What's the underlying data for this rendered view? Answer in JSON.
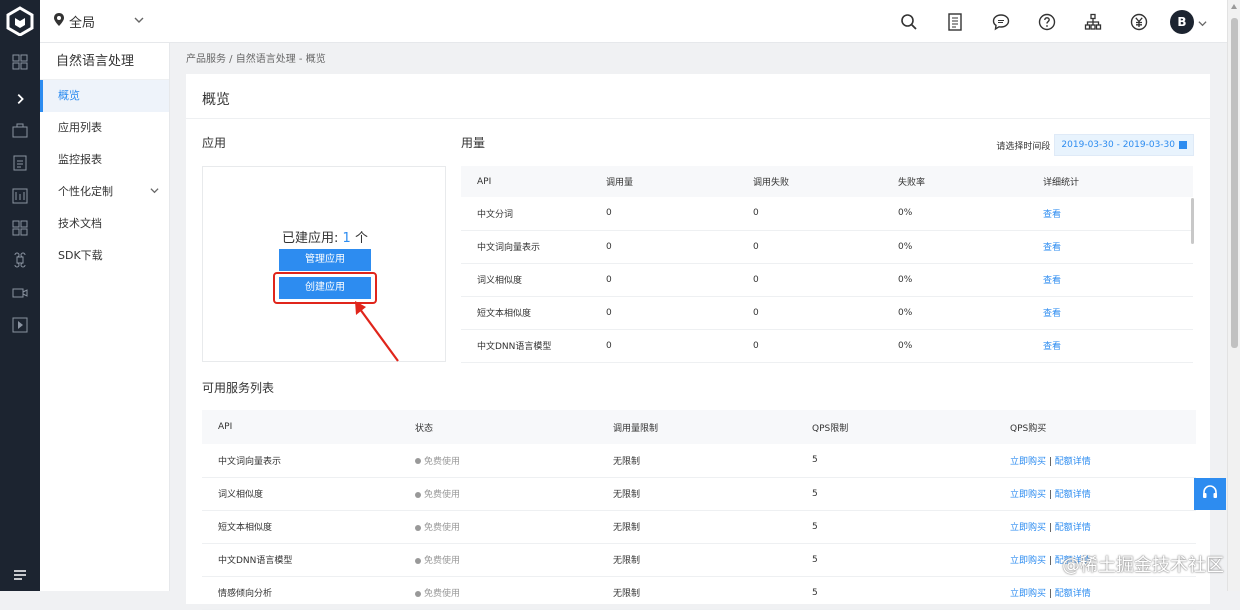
{
  "topbar": {
    "region": "全局",
    "avatar_letter": "B"
  },
  "icons": {
    "rail": [
      "grid-icon",
      "chevron-right-icon",
      "briefcase-icon",
      "doc-icon",
      "chart-doc-icon",
      "apps-icon",
      "command-icon",
      "video-icon",
      "play-icon",
      "menu-icon"
    ],
    "tools": [
      "search-icon",
      "document-icon",
      "chat-icon",
      "help-icon",
      "network-icon",
      "currency-icon"
    ]
  },
  "sidebar": {
    "title": "自然语言处理",
    "items": [
      {
        "label": "概览",
        "active": true
      },
      {
        "label": "应用列表"
      },
      {
        "label": "监控报表"
      },
      {
        "label": "个性化定制",
        "expandable": true
      },
      {
        "label": "技术文档"
      },
      {
        "label": "SDK下载"
      }
    ]
  },
  "breadcrumb": "产品服务 / 自然语言处理 - 概览",
  "page": {
    "title": "概览"
  },
  "apps": {
    "heading": "应用",
    "count_prefix": "已建应用: ",
    "count": "1",
    "count_suffix": " 个",
    "manage_label": "管理应用",
    "create_label": "创建应用"
  },
  "usage": {
    "heading": "用量",
    "date_label": "请选择时间段",
    "date_range": "2019-03-30 - 2019-03-30",
    "columns": [
      "API",
      "调用量",
      "调用失败",
      "失败率",
      "详细统计"
    ],
    "rows": [
      [
        "中文分词",
        "0",
        "0",
        "0%",
        "查看"
      ],
      [
        "中文词向量表示",
        "0",
        "0",
        "0%",
        "查看"
      ],
      [
        "词义相似度",
        "0",
        "0",
        "0%",
        "查看"
      ],
      [
        "短文本相似度",
        "0",
        "0",
        "0%",
        "查看"
      ],
      [
        "中文DNN语言模型",
        "0",
        "0",
        "0%",
        "查看"
      ]
    ]
  },
  "services": {
    "heading": "可用服务列表",
    "columns": [
      "API",
      "状态",
      "调用量限制",
      "QPS限制",
      "QPS购买"
    ],
    "rows": [
      {
        "api": "中文词向量表示",
        "status": "免费使用",
        "limit": "无限制",
        "qps": "5",
        "buy": "立即购买",
        "quota": "配额详情"
      },
      {
        "api": "词义相似度",
        "status": "免费使用",
        "limit": "无限制",
        "qps": "5",
        "buy": "立即购买",
        "quota": "配额详情"
      },
      {
        "api": "短文本相似度",
        "status": "免费使用",
        "limit": "无限制",
        "qps": "5",
        "buy": "立即购买",
        "quota": "配额详情"
      },
      {
        "api": "中文DNN语言模型",
        "status": "免费使用",
        "limit": "无限制",
        "qps": "5",
        "buy": "立即购买",
        "quota": "配额详情"
      },
      {
        "api": "情感倾向分析",
        "status": "免费使用",
        "limit": "无限制",
        "qps": "5",
        "buy": "立即购买",
        "quota": "配额详情"
      }
    ]
  },
  "watermark": "@稀土掘金技术社区",
  "colors": {
    "accent": "#2d8cf0",
    "rail": "#1c2430",
    "highlight": "#e0251b"
  }
}
